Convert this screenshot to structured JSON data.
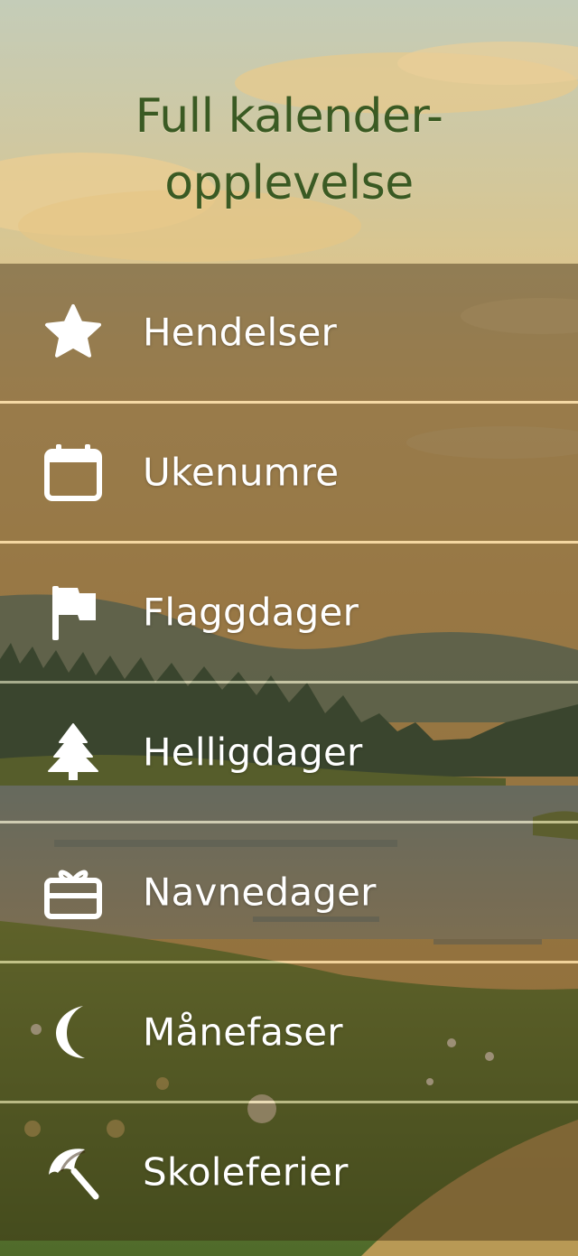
{
  "title": {
    "line1": "Full kalender-",
    "line2": "opplevelse"
  },
  "menu": {
    "items": [
      {
        "label": "Hendelser",
        "icon": "star-icon"
      },
      {
        "label": "Ukenumre",
        "icon": "calendar-icon"
      },
      {
        "label": "Flaggdager",
        "icon": "flag-icon"
      },
      {
        "label": "Helligdager",
        "icon": "tree-icon"
      },
      {
        "label": "Navnedager",
        "icon": "gift-icon"
      },
      {
        "label": "Månefaser",
        "icon": "moon-icon"
      },
      {
        "label": "Skoleferier",
        "icon": "umbrella-icon"
      }
    ]
  },
  "colors": {
    "title": "#3a5a23",
    "label": "#ffffff",
    "sky": "#c9d0bd",
    "meadow": "#6e8a3a"
  }
}
